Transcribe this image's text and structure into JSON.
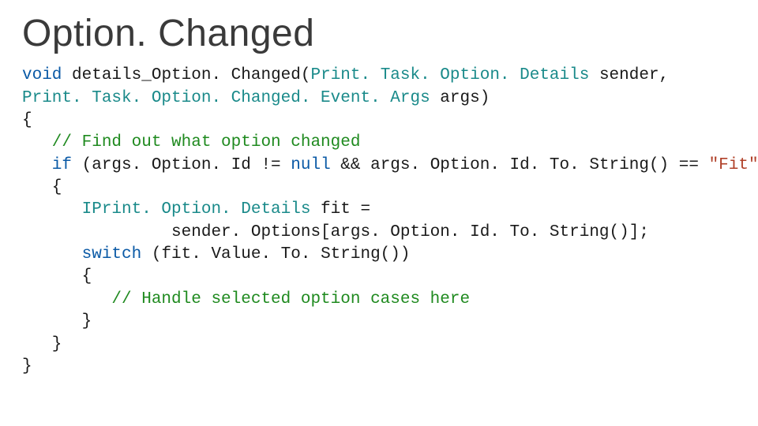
{
  "title": "Option. Changed",
  "code": {
    "kw_void": "void",
    "sig_name": " details_Option. Changed(",
    "type_ptod": "Print. Task. Option. Details",
    "sig_sender": " sender,",
    "type_ptoc": "Print. Task. Option. Changed. Event. Args",
    "sig_args": " args)",
    "brace_open": "{",
    "cmt1": "   // Find out what option changed",
    "kw_if": "   if",
    "if_cond1": " (args. Option. Id != ",
    "kw_null": "null",
    "if_cond2": " && args. Option. Id. To. String() == ",
    "str_fit": "\"Fit\"",
    "if_cond3": ")",
    "inner_brace_open": "   {",
    "type_ipod": "      IPrint. Option. Details",
    "fit_assign1": " fit =",
    "fit_assign2": "               sender. Options[args. Option. Id. To. String()];",
    "kw_switch": "      switch",
    "switch_expr": " (fit. Value. To. String())",
    "switch_brace_open": "      {",
    "cmt2": "         // Handle selected option cases here",
    "switch_brace_close": "      }",
    "inner_brace_close": "   }",
    "brace_close": "}"
  }
}
